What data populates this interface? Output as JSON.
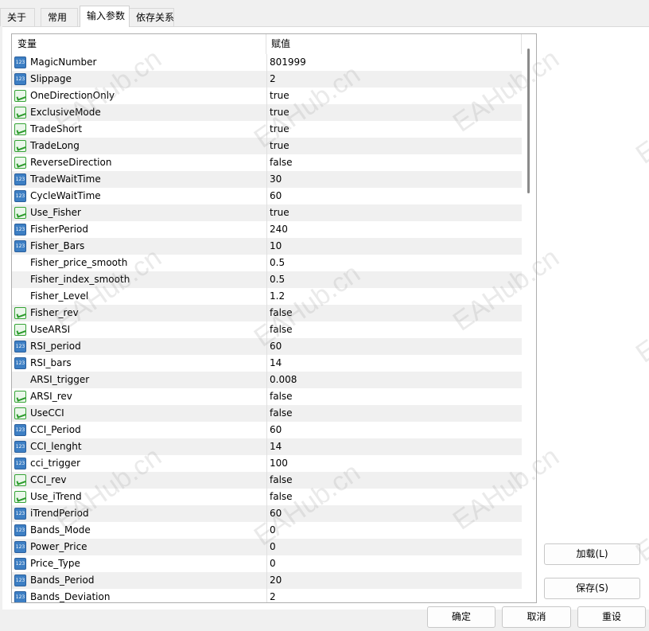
{
  "tabs": [
    {
      "label": "关于",
      "active": false
    },
    {
      "label": "常用",
      "active": false
    },
    {
      "label": "输入参数",
      "active": true
    },
    {
      "label": "依存关系",
      "active": false
    }
  ],
  "grid": {
    "col_variable": "变量",
    "col_value": "赋值",
    "rows": [
      {
        "name": "MagicNumber",
        "value": "801999",
        "type": "int"
      },
      {
        "name": "Slippage",
        "value": "2",
        "type": "int"
      },
      {
        "name": "OneDirectionOnly",
        "value": "true",
        "type": "bool"
      },
      {
        "name": "ExclusiveMode",
        "value": "true",
        "type": "bool"
      },
      {
        "name": "TradeShort",
        "value": "true",
        "type": "bool"
      },
      {
        "name": "TradeLong",
        "value": "true",
        "type": "bool"
      },
      {
        "name": "ReverseDirection",
        "value": "false",
        "type": "bool"
      },
      {
        "name": "TradeWaitTime",
        "value": "30",
        "type": "int"
      },
      {
        "name": "CycleWaitTime",
        "value": "60",
        "type": "int"
      },
      {
        "name": "Use_Fisher",
        "value": "true",
        "type": "bool"
      },
      {
        "name": "FisherPeriod",
        "value": "240",
        "type": "int"
      },
      {
        "name": "Fisher_Bars",
        "value": "10",
        "type": "int"
      },
      {
        "name": "Fisher_price_smooth",
        "value": "0.5",
        "type": "double"
      },
      {
        "name": "Fisher_index_smooth",
        "value": "0.5",
        "type": "double"
      },
      {
        "name": "Fisher_Level",
        "value": "1.2",
        "type": "double"
      },
      {
        "name": "Fisher_rev",
        "value": "false",
        "type": "bool"
      },
      {
        "name": "UseARSI",
        "value": "false",
        "type": "bool"
      },
      {
        "name": "RSI_period",
        "value": "60",
        "type": "int"
      },
      {
        "name": "RSI_bars",
        "value": "14",
        "type": "int"
      },
      {
        "name": "ARSI_trigger",
        "value": "0.008",
        "type": "double"
      },
      {
        "name": "ARSI_rev",
        "value": "false",
        "type": "bool"
      },
      {
        "name": "UseCCI",
        "value": "false",
        "type": "bool"
      },
      {
        "name": "CCI_Period",
        "value": "60",
        "type": "int"
      },
      {
        "name": "CCI_lenght",
        "value": "14",
        "type": "int"
      },
      {
        "name": "cci_trigger",
        "value": "100",
        "type": "int"
      },
      {
        "name": "CCI_rev",
        "value": "false",
        "type": "bool"
      },
      {
        "name": "Use_iTrend",
        "value": "false",
        "type": "bool"
      },
      {
        "name": "iTrendPeriod",
        "value": "60",
        "type": "int"
      },
      {
        "name": "Bands_Mode",
        "value": "0",
        "type": "int"
      },
      {
        "name": "Power_Price",
        "value": "0",
        "type": "int"
      },
      {
        "name": "Price_Type",
        "value": "0",
        "type": "int"
      },
      {
        "name": "Bands_Period",
        "value": "20",
        "type": "int"
      },
      {
        "name": "Bands_Deviation",
        "value": "2",
        "type": "int"
      }
    ]
  },
  "buttons": {
    "load": "加载(L)",
    "save": "保存(S)",
    "ok": "确定",
    "cancel": "取消",
    "reset": "重设"
  },
  "watermark": "EAHub.cn",
  "icons": {
    "int": "integer-icon",
    "bool": "boolean-icon",
    "double": "double-icon"
  }
}
